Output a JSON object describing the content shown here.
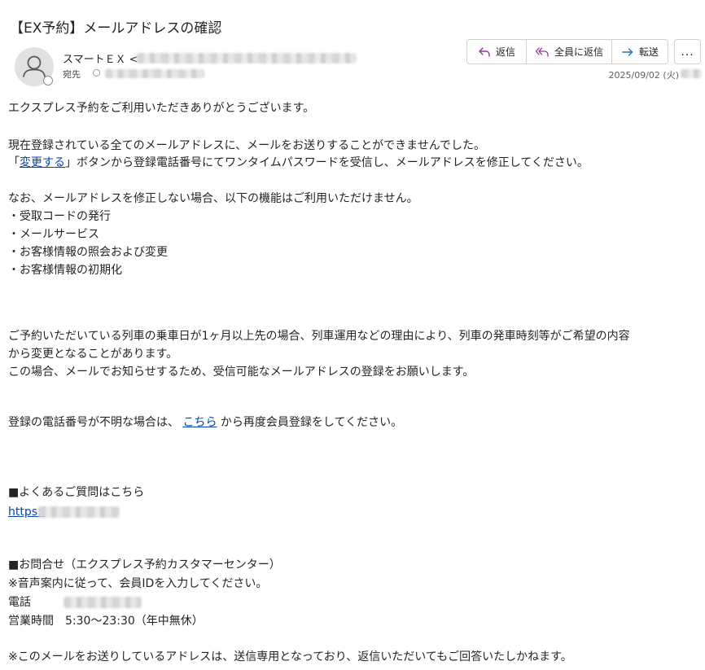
{
  "email": {
    "subject": "【EX予約】メールアドレスの確認",
    "sender_name": "スマートＥＸ <",
    "to_label": "宛先",
    "date": "2025/09/02 (火)"
  },
  "actions": {
    "reply": "返信",
    "reply_all": "全員に返信",
    "forward": "転送",
    "more": "..."
  },
  "body": {
    "greeting": "エクスプレス予約をご利用いただきありがとうございます。",
    "p1_line1": "現在登録されている全てのメールアドレスに、メールをお送りすることができませんでした。",
    "p1_line2_open": "「",
    "p1_link": "変更する",
    "p1_line2_rest": "」ボタンから登録電話番号にてワンタイムパスワードを受信し、メールアドレスを修正してください。",
    "p2_intro": "なお、メールアドレスを修正しない場合、以下の機能はご利用いただけません。",
    "list": [
      "・受取コードの発行",
      "・メールサービス",
      "・お客様情報の照会および変更",
      "・お客様情報の初期化"
    ],
    "p3_line1": "ご予約いただいている列車の乗車日が1ヶ月以上先の場合、列車運用などの理由により、列車の発車時刻等がご希望の内容",
    "p3_line2": "から変更となることがあります。",
    "p3_line3": "この場合、メールでお知らせするため、受信可能なメールアドレスの登録をお願いします。",
    "p4_before": "登録の電話番号が不明な場合は、",
    "p4_link": "こちら",
    "p4_after": "から再度会員登録をしてください。",
    "faq_heading": "■よくあるご質問はこちら",
    "faq_url": "https:/",
    "contact_heading": "■お問合せ（エクスプレス予約カスタマーセンター）",
    "contact_note": "※音声案内に従って、会員IDを入力してください。",
    "phone_label": "電話",
    "hours": "営業時間　5:30～23:30（年中無休）",
    "footer_note": "※このメールをお送りしているアドレスは、送信専用となっており、返信いただいてもご回答いたしかねます。"
  }
}
